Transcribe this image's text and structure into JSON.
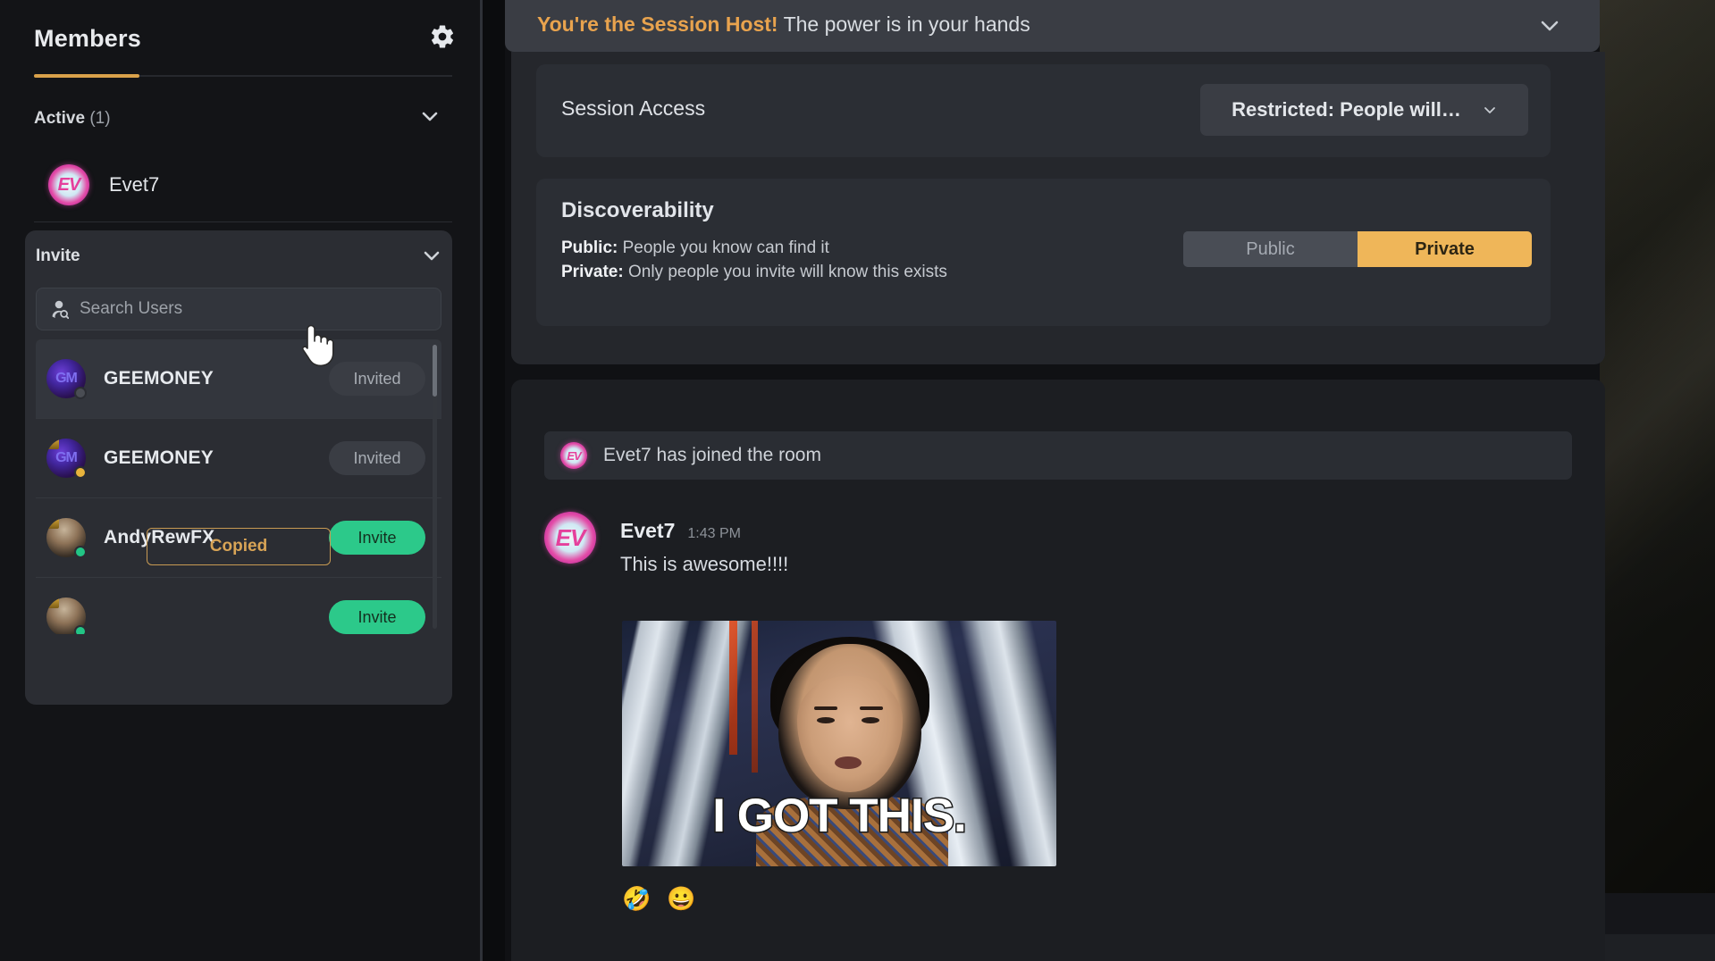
{
  "sidebar": {
    "title": "Members",
    "gear_icon": "gear-icon",
    "active_section": {
      "label": "Active",
      "count": "(1)",
      "chevron_icon": "chevron-down-icon"
    },
    "active_members": [
      {
        "name": "Evet7",
        "avatar_initials": "EV"
      }
    ],
    "invite": {
      "title": "Invite",
      "chevron_icon": "chevron-down-icon",
      "search_placeholder": "Search Users",
      "search_value": "",
      "search_icon": "user-search-icon",
      "users": [
        {
          "name": "GEEMONEY",
          "action_label": "Invited",
          "action_state": "invited",
          "status": "offline",
          "initials": "GM"
        },
        {
          "name": "GEEMONEY",
          "action_label": "Invited",
          "action_state": "invited",
          "status": "idle",
          "initials": "GM"
        },
        {
          "name": "AndyRewFX",
          "action_label": "Invite",
          "action_state": "invite",
          "status": "online",
          "initials": ""
        },
        {
          "name": "",
          "action_label": "Invite",
          "action_state": "invite",
          "status": "online",
          "initials": ""
        }
      ],
      "copy_link_label": "Copied"
    }
  },
  "host_banner": {
    "highlight": "You're the Session Host!",
    "rest": "The power is in your hands",
    "collapse_icon": "chevron-down-icon"
  },
  "session_access": {
    "label": "Session Access",
    "selected": "Restricted: People will…",
    "dropdown_icon": "chevron-down-icon"
  },
  "discoverability": {
    "title": "Discoverability",
    "public_line_label": "Public:",
    "public_line_text": " People you know can find it",
    "private_line_label": "Private:",
    "private_line_text": " Only people you invite will know this exists",
    "options": [
      "Public",
      "Private"
    ],
    "selected": "Private"
  },
  "chat": {
    "system_message": "Evet7 has joined the room",
    "system_avatar_initials": "EV",
    "message": {
      "author": "Evet7",
      "time": "1:43 PM",
      "text": "This is awesome!!!!",
      "avatar_initials": "EV",
      "attachment_caption": "I GOT THIS.",
      "reactions": [
        "🤣",
        "😀"
      ]
    }
  },
  "colors": {
    "accent_amber": "#d9a14a",
    "toggle_active": "#efb659",
    "invite_green": "#2cc98a",
    "panel_bg": "#2b2d33",
    "sidebar_bg": "#131417",
    "chat_bg": "#1c1e22"
  }
}
